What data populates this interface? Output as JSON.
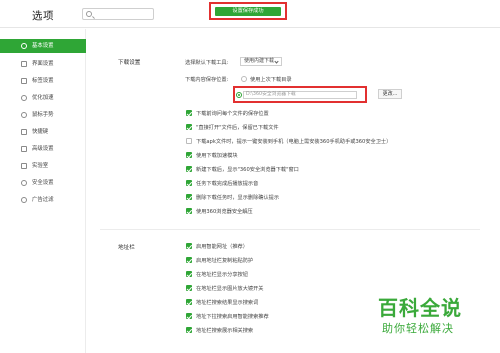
{
  "header": {
    "title": "选项",
    "search_placeholder": "",
    "save_label": "设置保存成功"
  },
  "sidebar": {
    "items": [
      {
        "label": "基本设置",
        "icon": "settings-icon"
      },
      {
        "label": "界面设置",
        "icon": "window-icon"
      },
      {
        "label": "标签设置",
        "icon": "tab-icon"
      },
      {
        "label": "优化加速",
        "icon": "speed-icon"
      },
      {
        "label": "鼠标手势",
        "icon": "mouse-icon"
      },
      {
        "label": "快捷键",
        "icon": "keyboard-icon"
      },
      {
        "label": "高级设置",
        "icon": "advanced-icon"
      },
      {
        "label": "实验室",
        "icon": "lab-icon"
      },
      {
        "label": "安全设置",
        "icon": "shield-icon"
      },
      {
        "label": "广告过滤",
        "icon": "adblock-icon"
      }
    ],
    "active_index": 0
  },
  "download": {
    "section_label": "下载设置",
    "tool_label": "选择默认下载工具:",
    "tool_value": "使用内建下载",
    "save_location_label": "下载内容保存位置:",
    "radio_last_dir": "使用上次下载目录",
    "path_value": "D:\\360安全浏览器下载",
    "change_label": "更改...",
    "options": [
      {
        "label": "下载前询问每个文件的保存位置",
        "checked": true
      },
      {
        "label": "\"直接打开\"文件后，保留已下载文件",
        "checked": true
      },
      {
        "label": "下载apk文件时，提示一键安装到手机（电脑上需安装360手机助手或360安全卫士）",
        "checked": false
      },
      {
        "label": "使用下载加速模块",
        "checked": true
      },
      {
        "label": "新建下载后，显示\"360安全浏览器下载\"窗口",
        "checked": true
      },
      {
        "label": "任务下载完成后播放提示音",
        "checked": true
      },
      {
        "label": "删除下载任务时，显示删除确认提示",
        "checked": true
      },
      {
        "label": "使用360浏览器安全解压",
        "checked": true
      }
    ]
  },
  "addressbar": {
    "section_label": "地址栏",
    "options": [
      {
        "label": "启用智能网址（推荐）",
        "checked": true
      },
      {
        "label": "启用地址栏复制粘贴防护",
        "checked": true
      },
      {
        "label": "在地址栏显示分享按钮",
        "checked": true
      },
      {
        "label": "在地址栏显示图片放大镜开关",
        "checked": true
      },
      {
        "label": "地址栏搜索结果显示搜索词",
        "checked": true
      },
      {
        "label": "地址下拉搜索启用智能搜索推荐",
        "checked": true
      },
      {
        "label": "地址栏搜索展示相关搜索",
        "checked": true
      }
    ]
  },
  "watermark": {
    "main": "百科全说",
    "sub": "助你轻松解决"
  },
  "colors": {
    "accent": "#2fa636",
    "highlight": "#e23030"
  }
}
